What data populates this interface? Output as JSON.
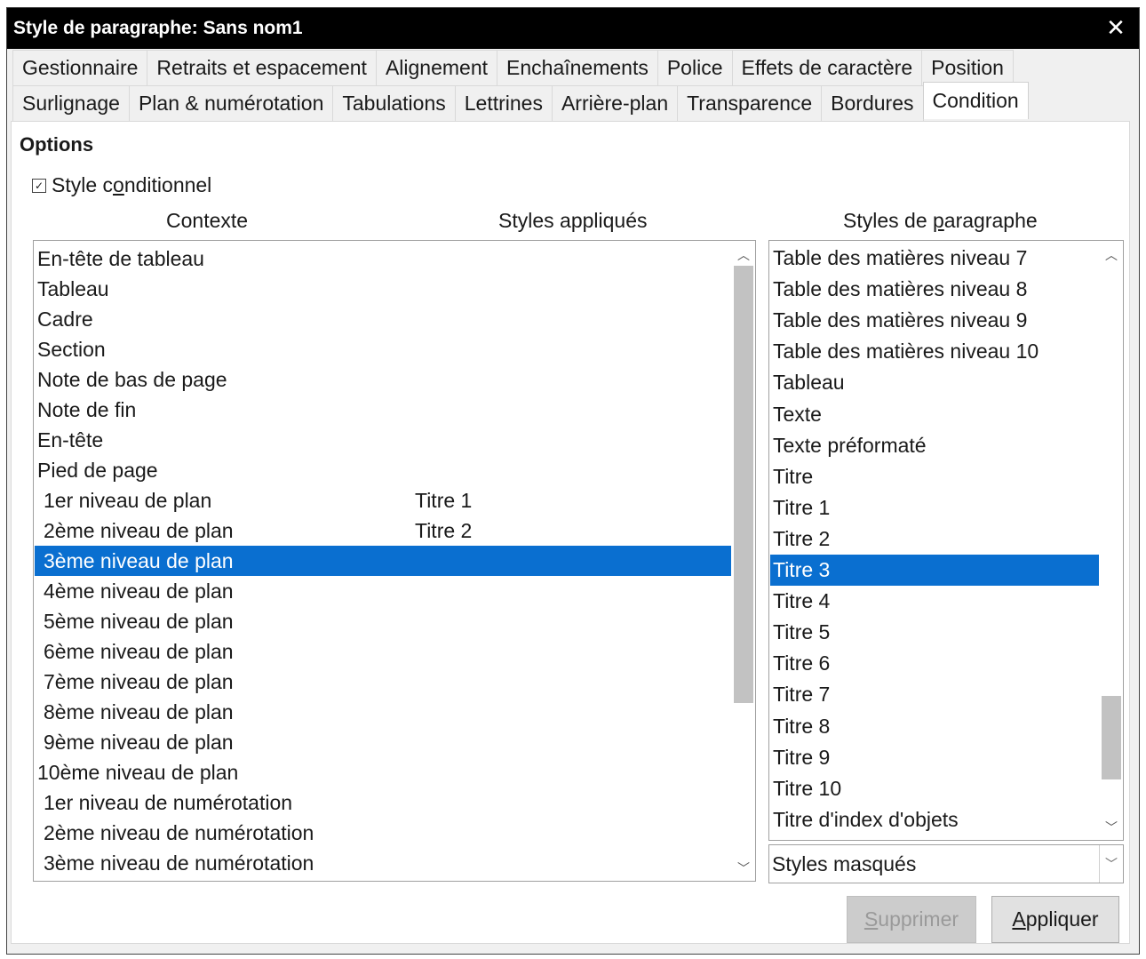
{
  "window": {
    "title": "Style de paragraphe: Sans nom1",
    "close_glyph": "✕"
  },
  "tabs_row1": [
    "Gestionnaire",
    "Retraits et espacement",
    "Alignement",
    "Enchaînements",
    "Police",
    "Effets de caractère",
    "Position"
  ],
  "tabs_row2": [
    "Surlignage",
    "Plan & numérotation",
    "Tabulations",
    "Lettrines",
    "Arrière-plan",
    "Transparence",
    "Bordures",
    "Condition"
  ],
  "active_tab": "Condition",
  "options": {
    "heading": "Options",
    "conditional": {
      "label_pre": "Style c",
      "label_accel": "o",
      "label_post": "nditionnel",
      "checked": true
    }
  },
  "columns": {
    "context": "Contexte",
    "applied": "Styles appliqués",
    "para_pre": "Styles de ",
    "para_accel": "p",
    "para_post": "aragraphe"
  },
  "context_rows": [
    {
      "context": "En-tête de tableau",
      "applied": ""
    },
    {
      "context": "Tableau",
      "applied": ""
    },
    {
      "context": "Cadre",
      "applied": ""
    },
    {
      "context": "Section",
      "applied": ""
    },
    {
      "context": "Note de bas de page",
      "applied": ""
    },
    {
      "context": "Note de fin",
      "applied": ""
    },
    {
      "context": "En-tête",
      "applied": ""
    },
    {
      "context": "Pied de page",
      "applied": ""
    },
    {
      "context": "1er niveau de plan",
      "applied": "Titre 1"
    },
    {
      "context": "2ème niveau de plan",
      "applied": "Titre 2"
    },
    {
      "context": "3ème niveau de plan",
      "applied": ""
    },
    {
      "context": "4ème niveau de plan",
      "applied": ""
    },
    {
      "context": "5ème niveau de plan",
      "applied": ""
    },
    {
      "context": "6ème niveau de plan",
      "applied": ""
    },
    {
      "context": "7ème niveau de plan",
      "applied": ""
    },
    {
      "context": "8ème niveau de plan",
      "applied": ""
    },
    {
      "context": "9ème niveau de plan",
      "applied": ""
    },
    {
      "context": "10ème niveau de plan",
      "applied": ""
    },
    {
      "context": "1er niveau de numérotation",
      "applied": ""
    },
    {
      "context": "2ème niveau de numérotation",
      "applied": ""
    },
    {
      "context": "3ème niveau de numérotation",
      "applied": ""
    }
  ],
  "context_selected": 10,
  "paragraph_styles": [
    "Table des matières niveau 7",
    "Table des matières niveau 8",
    "Table des matières niveau 9",
    "Table des matières niveau 10",
    "Tableau",
    "Texte",
    "Texte préformaté",
    "Titre",
    "Titre 1",
    "Titre 2",
    "Titre 3",
    "Titre 4",
    "Titre 5",
    "Titre 6",
    "Titre 7",
    "Titre 8",
    "Titre 9",
    "Titre 10",
    "Titre d'index d'objets"
  ],
  "paragraph_selected": 10,
  "filter": {
    "value": "Styles masqués"
  },
  "buttons": {
    "delete": {
      "pre": "",
      "accel": "S",
      "post": "upprimer",
      "enabled": false
    },
    "apply": {
      "pre": "",
      "accel": "A",
      "post": "ppliquer",
      "enabled": true
    }
  },
  "colors": {
    "selection": "#0a6fd0",
    "titlebar": "#000000"
  }
}
